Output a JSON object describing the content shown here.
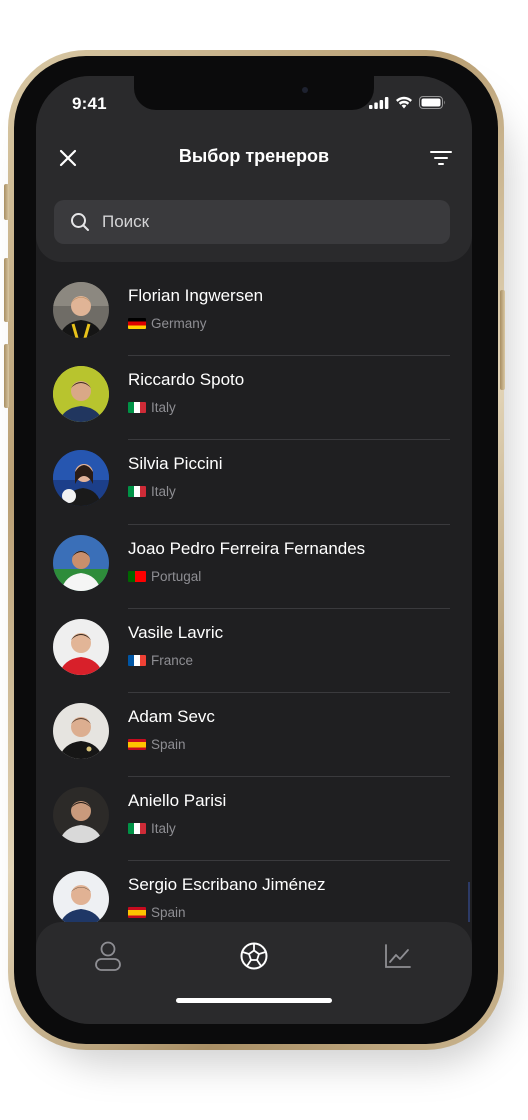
{
  "status_bar": {
    "time": "9:41"
  },
  "header": {
    "title": "Выбор тренеров",
    "close_icon": "close-icon",
    "filter_icon": "filter-icon"
  },
  "search": {
    "placeholder": "Поиск",
    "value": ""
  },
  "coaches": [
    {
      "name": "Florian Ingwersen",
      "country": "Germany",
      "flag": "germany-flag"
    },
    {
      "name": "Riccardo Spoto",
      "country": "Italy",
      "flag": "italy-flag"
    },
    {
      "name": "Silvia Piccini",
      "country": "Italy",
      "flag": "italy-flag"
    },
    {
      "name": "Joao Pedro Ferreira Fernandes",
      "country": "Portugal",
      "flag": "portugal-flag"
    },
    {
      "name": "Vasile Lavric",
      "country": "France",
      "flag": "france-flag"
    },
    {
      "name": "Adam Sevc",
      "country": "Spain",
      "flag": "spain-flag"
    },
    {
      "name": "Aniello Parisi",
      "country": "Italy",
      "flag": "italy-flag"
    },
    {
      "name": "Sergio Escribano Jiménez",
      "country": "Spain",
      "flag": "spain-flag"
    }
  ],
  "bottom_nav": {
    "items": [
      {
        "icon": "profile-icon"
      },
      {
        "icon": "soccer-ball-icon",
        "active": true
      },
      {
        "icon": "chart-icon"
      }
    ]
  },
  "colors": {
    "screen_bg": "#1f1f21",
    "panel_bg": "#2a2a2c",
    "search_bg": "#3a3a3d",
    "text_primary": "#ffffff",
    "text_secondary": "#8e8e93",
    "icon_inactive": "#8e8e93"
  }
}
